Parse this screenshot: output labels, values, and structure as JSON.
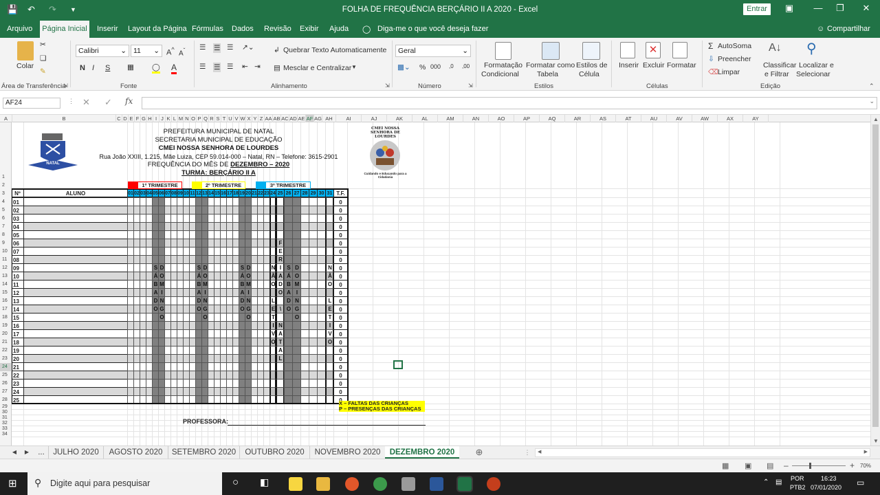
{
  "window": {
    "title": "FOLHA DE FREQUÊNCIA BERÇÁRIO II A 2020  -  Excel",
    "signin_label": "Entrar"
  },
  "ribbon_tabs": [
    "Arquivo",
    "Página Inicial",
    "Inserir",
    "Layout da Página",
    "Fórmulas",
    "Dados",
    "Revisão",
    "Exibir",
    "Ajuda"
  ],
  "tell_me": "Diga-me o que você deseja fazer",
  "share_label": "Compartilhar",
  "ribbon": {
    "paste": "Colar",
    "clipboard_group": "Área de Transferência",
    "font_name": "Calibri",
    "font_size": "11",
    "bold": "N",
    "italic": "I",
    "underline": "S",
    "font_group": "Fonte",
    "wrap_text": "Quebrar Texto Automaticamente",
    "merge_center": "Mesclar e Centralizar",
    "alignment_group": "Alinhamento",
    "number_format": "Geral",
    "number_group": "Número",
    "cond_format": [
      "Formatação",
      "Condicional"
    ],
    "format_table": [
      "Formatar como",
      "Tabela"
    ],
    "cell_styles": [
      "Estilos de",
      "Célula"
    ],
    "styles_group": "Estilos",
    "insert": "Inserir",
    "delete": "Excluir",
    "format": "Formatar",
    "cells_group": "Células",
    "autosum": "AutoSoma",
    "fill": "Preencher",
    "clear": "Limpar",
    "sort_filter": [
      "Classificar",
      "e Filtrar"
    ],
    "find_select": [
      "Localizar e",
      "Selecionar"
    ],
    "editing_group": "Edição"
  },
  "name_box": "AF24",
  "formula": "",
  "columns": [
    "A",
    "B",
    "C",
    "D",
    "E",
    "F",
    "G",
    "H",
    "I",
    "J",
    "K",
    "L",
    "M",
    "N",
    "O",
    "P",
    "Q",
    "R",
    "S",
    "T",
    "U",
    "V",
    "W",
    "X",
    "Y",
    "Z",
    "AA",
    "AB",
    "AC",
    "AD",
    "AE",
    "AF",
    "AG",
    "AH",
    "AI",
    "AJ",
    "AK",
    "AL",
    "AM",
    "AN",
    "AO",
    "AP",
    "AQ",
    "AR",
    "AS",
    "AT",
    "AU",
    "AV",
    "AW",
    "AX",
    "AY"
  ],
  "rows": [
    "1",
    "2",
    "3",
    "4",
    "5",
    "6",
    "7",
    "8",
    "9",
    "10",
    "11",
    "12",
    "13",
    "14",
    "15",
    "16",
    "17",
    "18",
    "19",
    "20",
    "21",
    "22",
    "23",
    "24",
    "25",
    "26",
    "27",
    "28",
    "29",
    "30",
    "31",
    "32",
    "33",
    "34"
  ],
  "header": {
    "line1": "PREFEITURA MUNICIPAL DE NATAL",
    "line2": "SECRETARIA MUNICIPAL DE EDUCAÇÃO",
    "line3": "CMEI NOSSA SENHORA DE LOURDES",
    "line4": "Rua João XXIII, 1.215, Mãe Luiza, CEP 59.014-000 – Natal, RN – Telefone: 3615-2901",
    "line5_prefix": "FREQUÊNCIA DO MÊS DE ",
    "line5_month": "DEZEMBRO – 2020",
    "line6_prefix": "TURMA: ",
    "line6_class": "BERÇÁRIO II A",
    "logo_text": "NATAL",
    "school_logo_title": "CMEI NOSSA SENHORA DE LOURDES",
    "school_logo_motto": "Cuidando e Educando para a Cidadania"
  },
  "legend": {
    "t1": "1º TRIMESTRE",
    "t2": "2º TRIMESTRE",
    "t3": "3º TRIMESTRE",
    "t1_color": "#ff0000",
    "t2_color": "#ffff00",
    "t3_color": "#00b0f0"
  },
  "table": {
    "no_label": "Nº",
    "student_label": "ALUNO",
    "tf_label": "T.F.",
    "days": [
      "01",
      "02",
      "03",
      "04",
      "05",
      "06",
      "07",
      "08",
      "09",
      "10",
      "11",
      "12",
      "13",
      "14",
      "15",
      "16",
      "17",
      "18",
      "19",
      "20",
      "21",
      "22",
      "23",
      "24",
      "25",
      "26",
      "27",
      "28",
      "29",
      "30",
      "31"
    ],
    "numbers": [
      "01",
      "02",
      "03",
      "04",
      "05",
      "06",
      "07",
      "08",
      "09",
      "10",
      "11",
      "12",
      "13",
      "14",
      "15",
      "16",
      "17",
      "18",
      "19",
      "20",
      "21",
      "22",
      "23",
      "24",
      "25"
    ],
    "tf_values": [
      "0",
      "0",
      "0",
      "0",
      "0",
      "0",
      "0",
      "0",
      "0",
      "0",
      "0",
      "0",
      "0",
      "0",
      "0",
      "0",
      "0",
      "0",
      "0",
      "0",
      "0",
      "0",
      "0",
      "0",
      "0"
    ],
    "day_header_color": "#00b0f0",
    "weekend_color": "#808080",
    "saturday_word": [
      "S",
      "Á",
      "B",
      "A",
      "D",
      "O"
    ],
    "sunday_word": [
      "D",
      "O",
      "M",
      "I",
      "N",
      "G",
      "O"
    ],
    "nao_word": [
      "N",
      "Ã",
      "O"
    ],
    "letivo_word": [
      "L",
      "E",
      "T",
      "I",
      "V",
      "O"
    ],
    "feriado_word": [
      "F",
      "E",
      "R",
      "I",
      "A",
      "D",
      "O"
    ],
    "natal_word": [
      "N",
      "A",
      "T",
      "A",
      "L"
    ],
    "christmas_sep": "\\"
  },
  "notes": {
    "faltas": "X – FALTAS DAS CRIANÇAS",
    "presencas": "P – PRESENÇAS DAS CRIANÇAS",
    "professora": "PROFESSORA:"
  },
  "sheet_tabs": [
    "...",
    "JULHO 2020",
    "AGOSTO 2020",
    "SETEMBRO 2020",
    "OUTUBRO 2020",
    "NOVEMBRO 2020",
    "DEZEMBRO 2020"
  ],
  "active_tab": "DEZEMBRO 2020",
  "status": {
    "zoom": "70%"
  },
  "taskbar": {
    "search_placeholder": "Digite aqui para pesquisar",
    "lang1": "POR",
    "lang2": "PTB2",
    "time": "16:23",
    "date": "07/01/2020"
  }
}
